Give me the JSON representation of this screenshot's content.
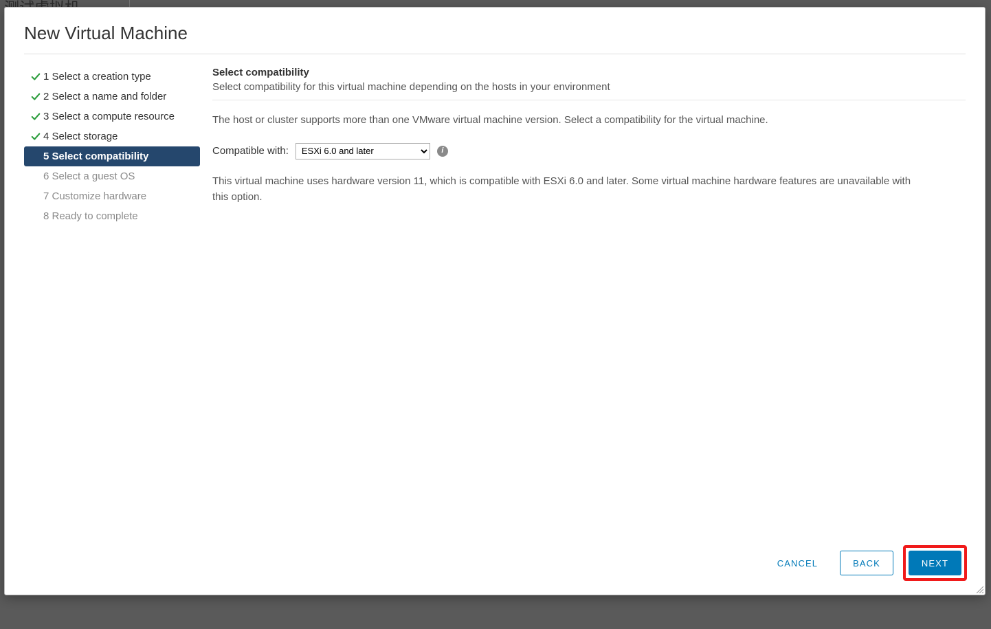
{
  "backdrop_text": "测试虚拟机",
  "dialog": {
    "title": "New Virtual Machine"
  },
  "steps": [
    {
      "label": "1 Select a creation type",
      "state": "done"
    },
    {
      "label": "2 Select a name and folder",
      "state": "done"
    },
    {
      "label": "3 Select a compute resource",
      "state": "done"
    },
    {
      "label": "4 Select storage",
      "state": "done"
    },
    {
      "label": "5 Select compatibility",
      "state": "current"
    },
    {
      "label": "6 Select a guest OS",
      "state": "upcoming"
    },
    {
      "label": "7 Customize hardware",
      "state": "upcoming"
    },
    {
      "label": "8 Ready to complete",
      "state": "upcoming"
    }
  ],
  "content": {
    "heading": "Select compatibility",
    "subheading": "Select compatibility for this virtual machine depending on the hosts in your environment",
    "intro": "The host or cluster supports more than one VMware virtual machine version. Select a compatibility for the virtual machine.",
    "compat_label": "Compatible with:",
    "compat_selected": "ESXi 6.0 and later",
    "description": "This virtual machine uses hardware version 11, which is compatible with ESXi 6.0 and later. Some virtual machine hardware features are unavailable with this option."
  },
  "footer": {
    "cancel": "CANCEL",
    "back": "BACK",
    "next": "NEXT"
  }
}
